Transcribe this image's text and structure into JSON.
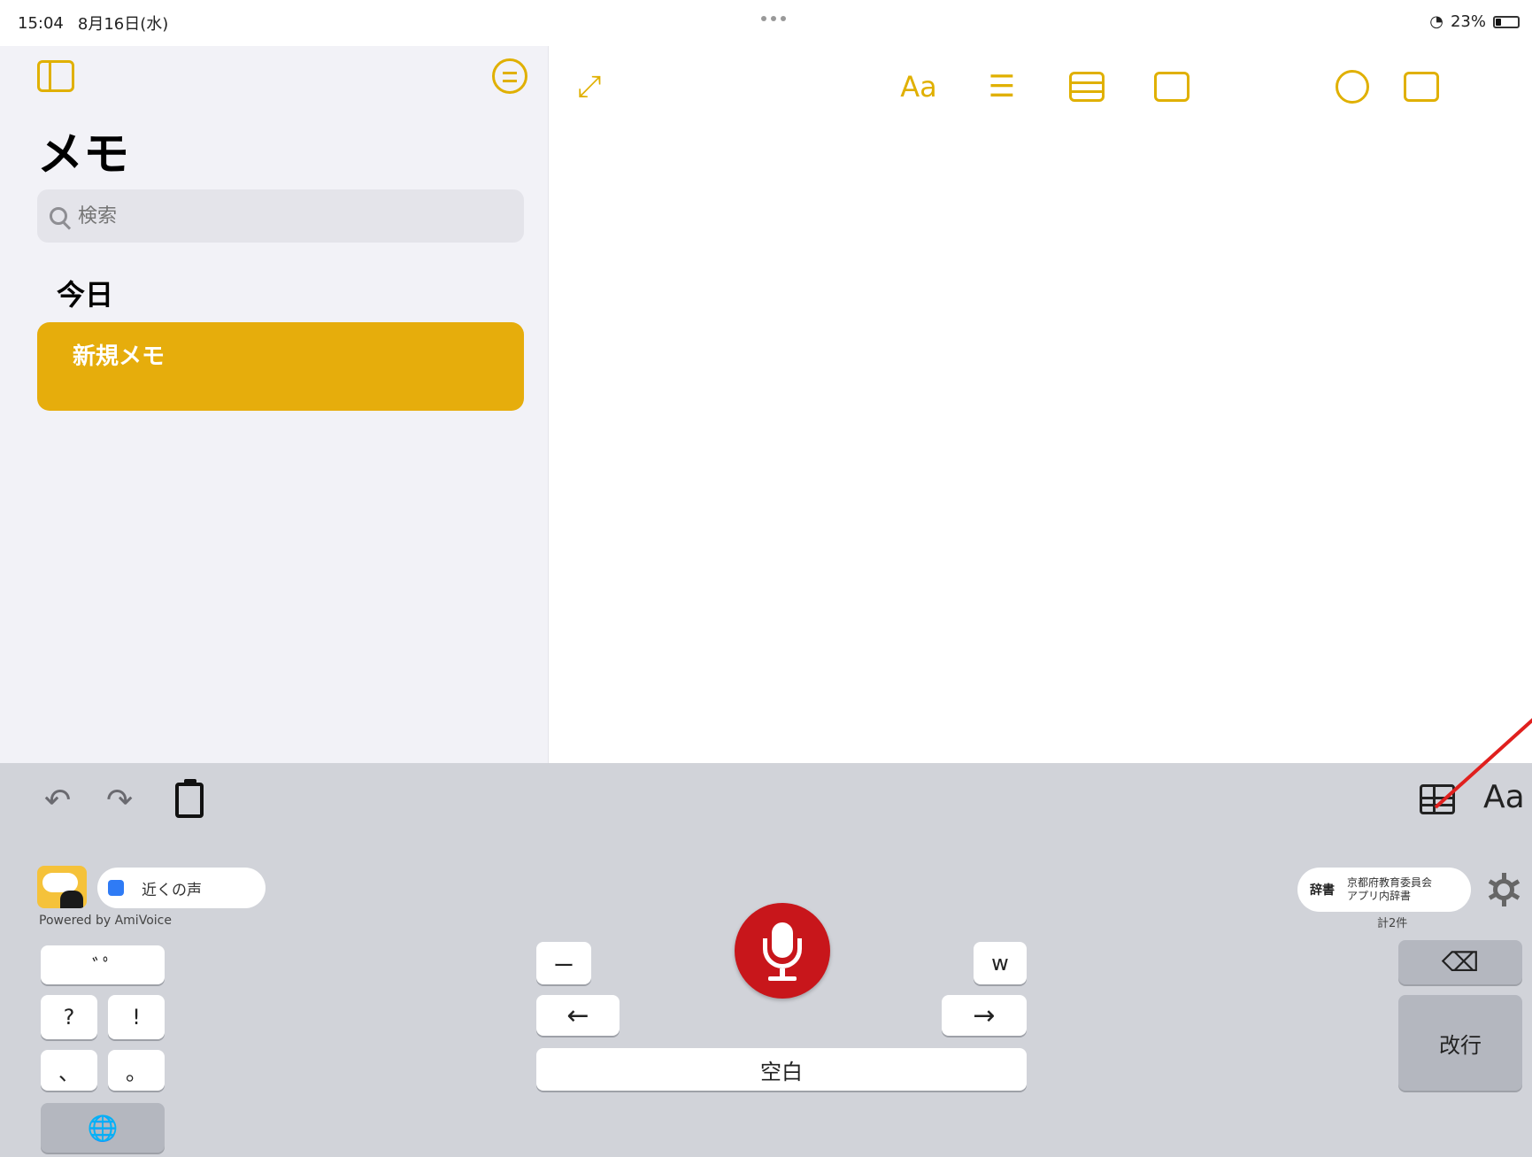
{
  "status_bar": {
    "time": "15:04",
    "date": "8月16日(水)",
    "battery": "23%",
    "battery_level": 0.23
  },
  "sidebar": {
    "title": "メモ",
    "search_placeholder": "検索",
    "section": "今日",
    "note": {
      "title": "新規メモ",
      "subtitle": "",
      "color": "#e6ad0c"
    }
  },
  "note_toolbar": {
    "format_label": "Aa",
    "accent": "#e0b000"
  },
  "keyboard_toolbar": {
    "undo": "↶",
    "redo": "↷",
    "format_label": "Aa"
  },
  "keyboard": {
    "voice_label": "近くの声",
    "powered_by": "Powered by AmiVoice",
    "dict_tag": "辞書",
    "dict_line1": "京都府教育委員会",
    "dict_line2": "アプリ内辞書",
    "dict_count": "計2件",
    "keys": {
      "kana": "ﾞﾟ",
      "question": "?",
      "exclaim": "!",
      "comma": "、",
      "period": "。",
      "globe": "🌐",
      "dash": "ー",
      "left": "←",
      "w": "w",
      "right": "→",
      "space": "空白",
      "delete": "⌫",
      "return": "改行"
    },
    "mic_color": "#c8161b",
    "background": "#d1d3d9"
  }
}
